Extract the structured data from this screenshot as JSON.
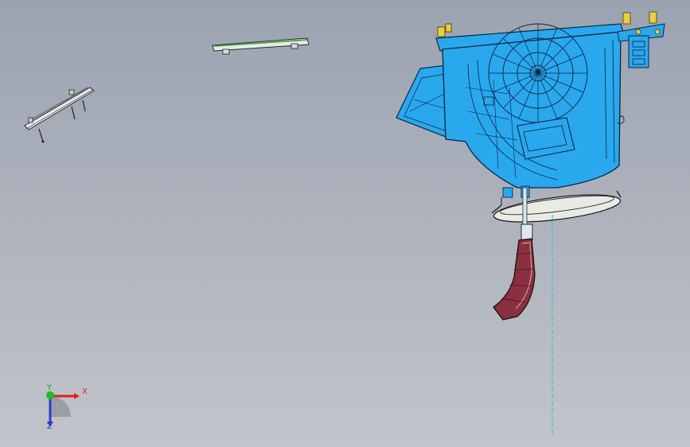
{
  "viewport": {
    "background_top": "#9ba3b1",
    "background_bottom": "#c2c4ca"
  },
  "triad": {
    "x_label": "X",
    "y_label": "Y",
    "z_label": "Z",
    "x_color": "#e02020",
    "y_color": "#18c018",
    "z_color": "#2a3ad0"
  },
  "model": {
    "housing_color": "#29a8ee",
    "duct_color": "#8a3040",
    "fastener_color": "#e8d040",
    "centerline_color": "#20c8d8",
    "icons": [
      "fan-housing-icon",
      "duct-outlet-icon",
      "mounting-bracket-icon",
      "rail-part-icon"
    ]
  }
}
